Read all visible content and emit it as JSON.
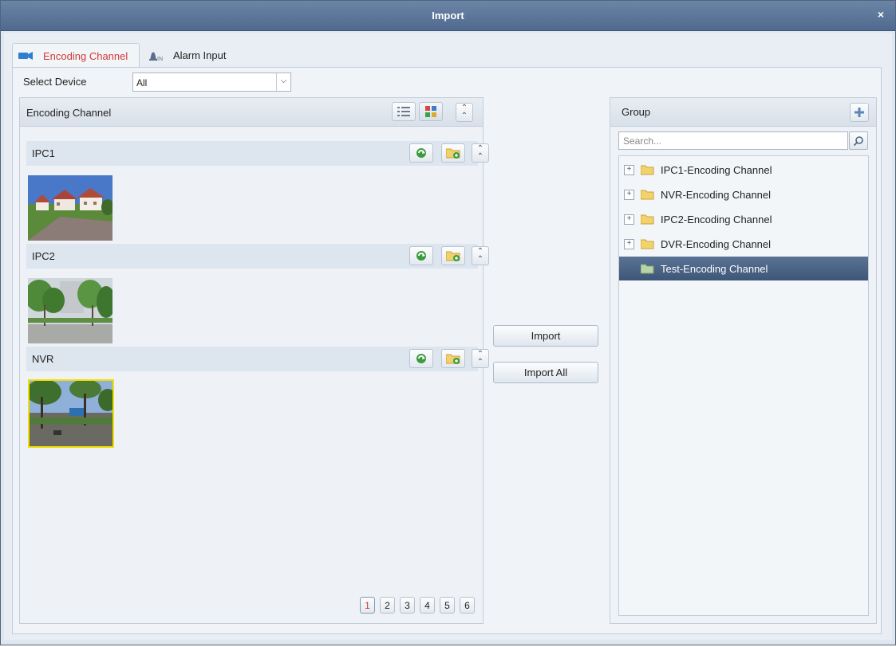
{
  "window": {
    "title": "Import",
    "close_glyph": "×"
  },
  "tabs": [
    {
      "label": "Encoding Channel",
      "icon": "camera-icon",
      "active": true
    },
    {
      "label": "Alarm Input",
      "icon": "alarm-input-icon",
      "active": false
    }
  ],
  "select_device": {
    "label": "Select Device",
    "value": "All"
  },
  "left_panel": {
    "title": "Encoding Channel",
    "devices": [
      {
        "name": "IPC1",
        "thumbnail": "houses-scene",
        "selected": false
      },
      {
        "name": "IPC2",
        "thumbnail": "trees-park-scene",
        "selected": false
      },
      {
        "name": "NVR",
        "thumbnail": "street-trees-scene",
        "selected": true
      }
    ],
    "pages": [
      "1",
      "2",
      "3",
      "4",
      "5",
      "6"
    ],
    "current_page": "1"
  },
  "actions": {
    "import": "Import",
    "import_all": "Import All"
  },
  "group_panel": {
    "title": "Group",
    "search_placeholder": "Search...",
    "groups": [
      {
        "label": "IPC1-Encoding Channel",
        "selected": false
      },
      {
        "label": "NVR-Encoding Channel",
        "selected": false
      },
      {
        "label": "IPC2-Encoding Channel",
        "selected": false
      },
      {
        "label": "DVR-Encoding Channel",
        "selected": false
      },
      {
        "label": "Test-Encoding Channel",
        "selected": true
      }
    ]
  },
  "colors": {
    "title_bar": "#5a7396",
    "active_tab_text": "#d0393a",
    "selected_row": "#4a6285",
    "selected_thumb_border": "#f0e000"
  }
}
